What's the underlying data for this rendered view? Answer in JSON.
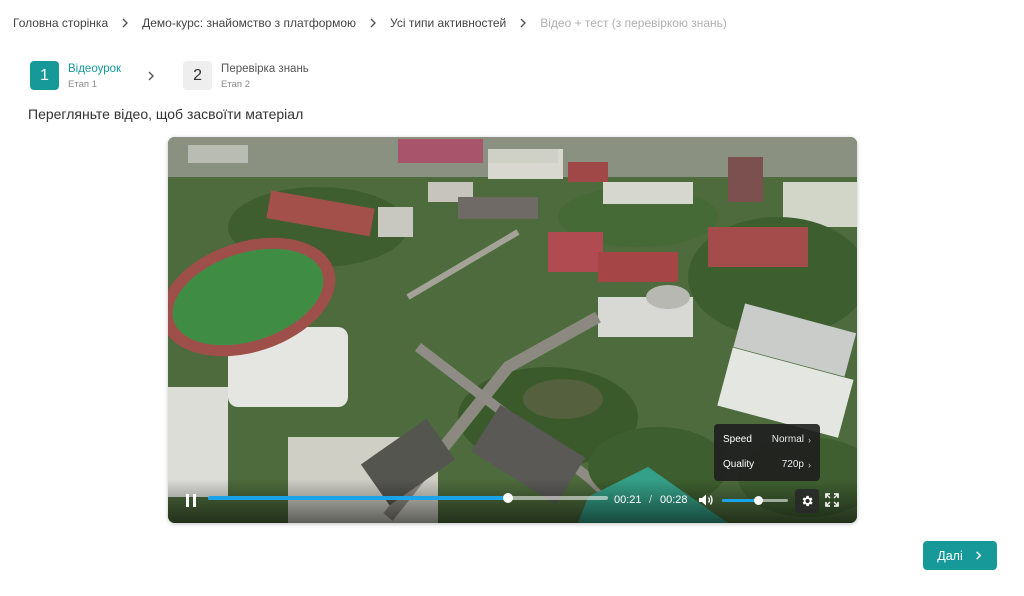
{
  "breadcrumb": [
    {
      "label": "Головна сторінка"
    },
    {
      "label": "Демо-курс: знайомство з платформою"
    },
    {
      "label": "Усі типи активностей"
    },
    {
      "label": "Відео + тест (з перевіркою знань)"
    }
  ],
  "steps": [
    {
      "number": "1",
      "title": "Відеоурок",
      "subtitle": "Етап 1",
      "state": "active"
    },
    {
      "number": "2",
      "title": "Перевірка знань",
      "subtitle": "Етап 2",
      "state": "inactive"
    }
  ],
  "instruction": "Перегляньте відео, щоб засвоїти матеріал",
  "player": {
    "current_time": "00:21",
    "time_separator": "/",
    "duration": "00:28",
    "progress": 0.75,
    "volume": 0.55,
    "state": "playing",
    "settings_menu": {
      "speed_label": "Speed",
      "speed_value": "Normal",
      "quality_label": "Quality",
      "quality_value": "720p"
    }
  },
  "next_button": {
    "label": "Далі"
  },
  "colors": {
    "accent": "#17999a",
    "progress": "#1aa3e8",
    "muted_text": "#b0b0b0"
  },
  "icons": {
    "breadcrumb_separator": "chevron-right-icon",
    "pause": "pause-icon",
    "volume": "volume-icon",
    "settings": "gear-icon",
    "fullscreen": "fullscreen-icon",
    "next": "chevron-right-icon"
  }
}
